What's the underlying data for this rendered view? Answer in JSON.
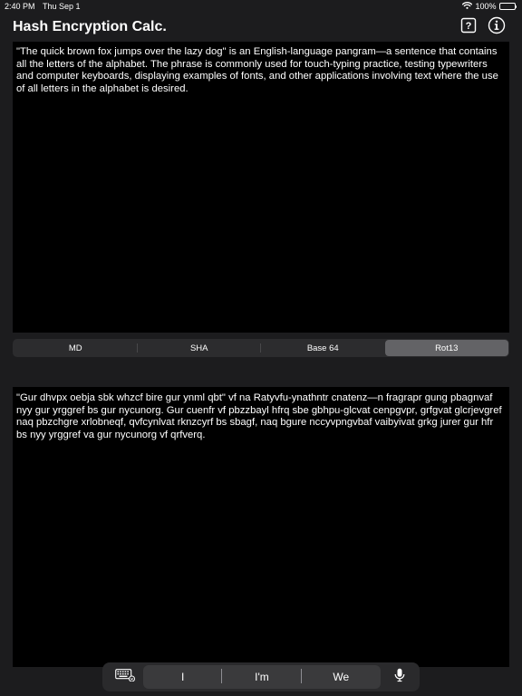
{
  "status_bar": {
    "time": "2:40 PM",
    "date": "Thu Sep 1",
    "battery": "100%"
  },
  "nav": {
    "title": "Hash Encryption Calc."
  },
  "input": {
    "text": "\"The quick brown fox jumps over the lazy dog\" is an English-language pangram—a sentence that contains all the letters of the alphabet. The phrase is commonly used for touch-typing practice, testing typewriters and computer keyboards, displaying examples of fonts, and other applications involving text where the use of all letters in the alphabet is desired."
  },
  "segments": {
    "items": [
      {
        "label": "MD"
      },
      {
        "label": "SHA"
      },
      {
        "label": "Base 64"
      },
      {
        "label": "Rot13"
      }
    ],
    "selected": "Rot13"
  },
  "output": {
    "text": "\"Gur dhvpx oebja sbk whzcf bire gur ynml qbt\" vf na Ratyvfu-ynathntr cnatenz—n fragrapr gung pbagnvaf nyy gur yrggref bs gur nycunorg. Gur cuenfr vf pbzzbayl hfrq sbe gbhpu-glcvat cenpgvpr, grfgvat glcrjevgref naq pbzchgre xrlobneqf, qvfcynlvat rknzcyrf bs sbagf, naq bgure nccyvpngvbaf vaibyivat grkg jurer gur hfr bs nyy yrggref va gur nycunorg vf qrfverq."
  },
  "keyboard": {
    "suggestions": [
      "I",
      "I'm",
      "We"
    ]
  },
  "colors": {
    "background": "#1c1c1e",
    "text_area": "#000000",
    "segment_selected": "#636366"
  },
  "icons": {
    "help": "question-mark-square-icon",
    "info": "info-circle-icon",
    "wifi": "wifi-icon",
    "battery": "battery-icon",
    "keyboard": "keyboard-icon",
    "mic": "microphone-icon"
  }
}
